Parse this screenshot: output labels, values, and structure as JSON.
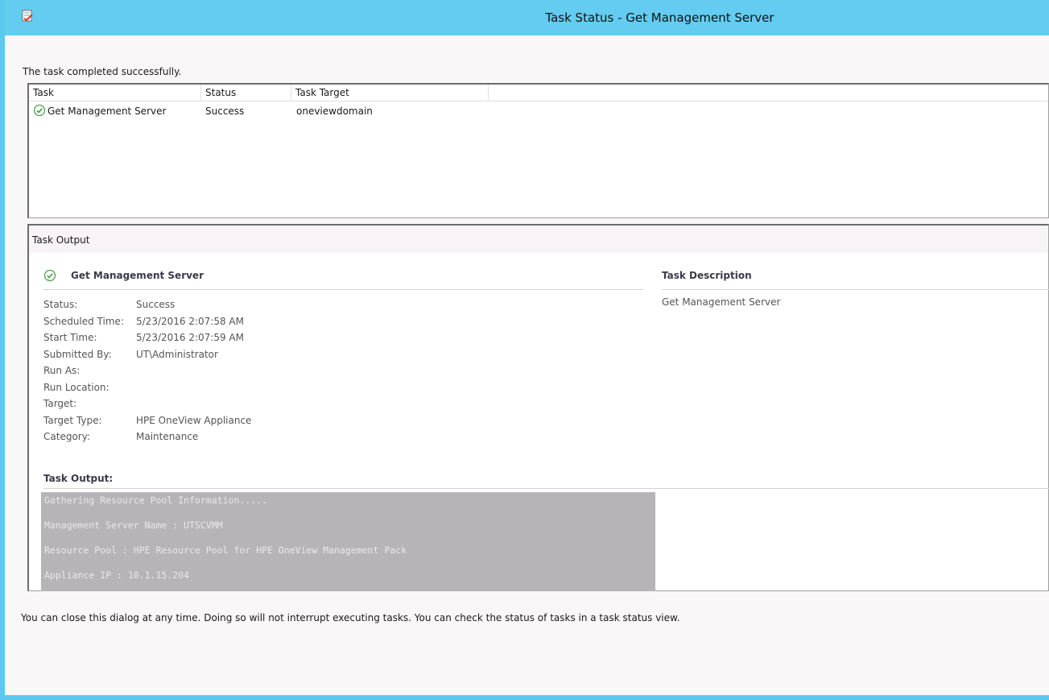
{
  "window": {
    "title": "Task Status - Get Management Server"
  },
  "status_message": "The task completed successfully.",
  "task_list": {
    "columns": [
      "Task",
      "Status",
      "Task Target"
    ],
    "rows": [
      {
        "task": "Get Management Server",
        "status": "Success",
        "target": "oneviewdomain"
      }
    ]
  },
  "output": {
    "header": "Task Output",
    "task_name": "Get Management Server",
    "description_title": "Task Description",
    "description_value": "Get Management Server",
    "properties": [
      {
        "label": "Status:",
        "value": "Success"
      },
      {
        "label": "Scheduled Time:",
        "value": "5/23/2016 2:07:58 AM"
      },
      {
        "label": "Start Time:",
        "value": "5/23/2016 2:07:59 AM"
      },
      {
        "label": "Submitted By:",
        "value": "UT\\Administrator"
      },
      {
        "label": "Run As:",
        "value": ""
      },
      {
        "label": "Run Location:",
        "value": ""
      },
      {
        "label": "Target:",
        "value": ""
      },
      {
        "label": "Target Type:",
        "value": "HPE OneView Appliance"
      },
      {
        "label": "Category:",
        "value": "Maintenance"
      }
    ],
    "output_title": "Task Output:",
    "console_lines": [
      "Gathering Resource Pool Information.....",
      "Management Server Name : UTSCVMM",
      "Resource Pool : HPE Resource Pool for HPE OneView Management Pack",
      "Appliance IP : 10.1.15.204"
    ]
  },
  "footer_message": "You can close this dialog at any time. Doing so will not interrupt executing tasks. You can check the status of tasks in a task status view.",
  "colors": {
    "titlebar": "#63ccf0",
    "success_green": "#3aa13a",
    "console_bg": "#b6b4b6"
  }
}
